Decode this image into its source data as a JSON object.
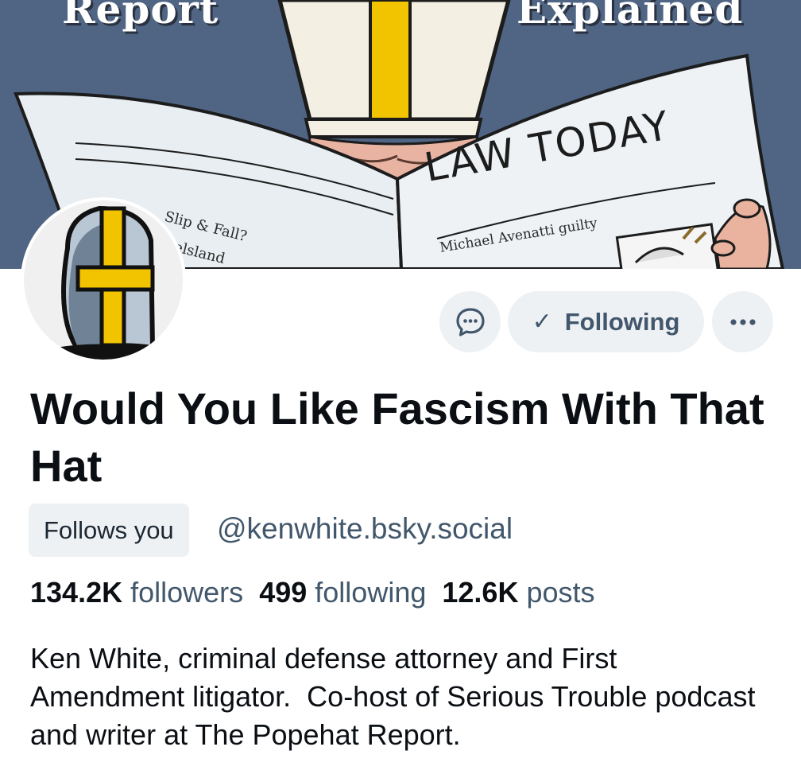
{
  "banner": {
    "title_left": "Report",
    "title_right": "Explained",
    "paper_masthead": "LAW TODAY",
    "paper_headline_left": "Slip & Fall?",
    "paper_headline_left_2": "elsland",
    "paper_headline_right": "Michael Avenatti guilty",
    "background_color": "#4f6583"
  },
  "actions": {
    "message_icon": "chat-bubble-icon",
    "following_label": "Following",
    "check_icon": "check-icon",
    "more_icon": "ellipsis-icon"
  },
  "profile": {
    "display_name": "Would You Like Fascism With That Hat",
    "follows_you_badge": "Follows you",
    "handle": "@kenwhite.bsky.social",
    "followers_count": "134.2K",
    "followers_label": "followers",
    "following_count": "499",
    "following_label": "following",
    "posts_count": "12.6K",
    "posts_label": "posts",
    "bio": "Ken White, criminal defense attorney and First Amendment litigator.  Co-host of Serious Trouble podcast and writer at The Popehat Report."
  },
  "colors": {
    "accent_text": "#42576c",
    "button_bg": "#eef1f4",
    "hat_yellow": "#f2c400"
  }
}
